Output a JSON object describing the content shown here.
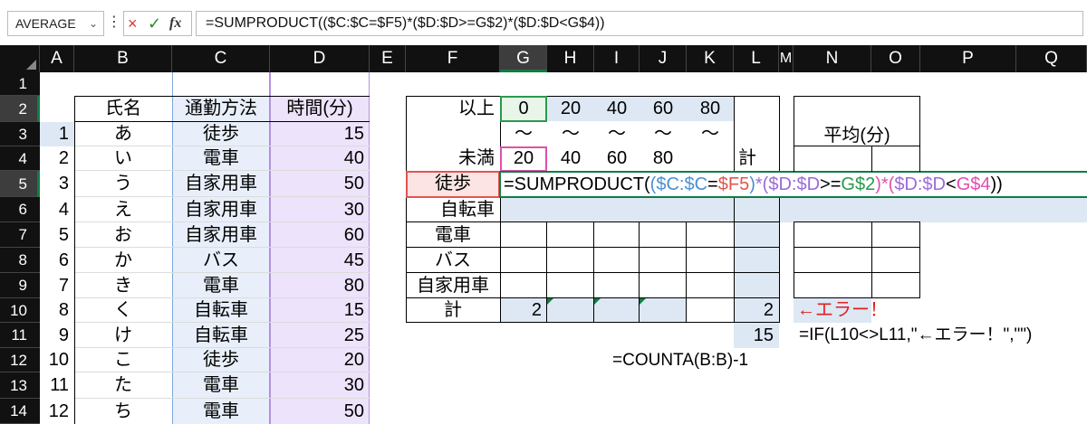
{
  "namebox": {
    "value": "AVERAGE",
    "chevron": "⌄"
  },
  "formula_bar": {
    "dots": "⋮",
    "cancel_icon": "×",
    "enter_icon": "✓",
    "fx_label": "fx",
    "text": "=SUMPRODUCT(($C:$C=$F5)*($D:$D>=G$2)*($D:$D<G$4))"
  },
  "columns": [
    "A",
    "B",
    "C",
    "D",
    "E",
    "F",
    "G",
    "H",
    "I",
    "J",
    "K",
    "L",
    "M",
    "N",
    "O",
    "P",
    "Q"
  ],
  "selected_column": "G",
  "rows": [
    "1",
    "2",
    "3",
    "4",
    "5",
    "6",
    "7",
    "8",
    "9",
    "10",
    "11",
    "12",
    "13",
    "14"
  ],
  "selected_rows": [
    "2",
    "5"
  ],
  "people": {
    "header": {
      "name": "氏名",
      "method": "通勤方法",
      "time": "時間(分)"
    },
    "list": [
      {
        "no": "1",
        "name": "あ",
        "method": "徒歩",
        "time": "15"
      },
      {
        "no": "2",
        "name": "い",
        "method": "電車",
        "time": "40"
      },
      {
        "no": "3",
        "name": "う",
        "method": "自家用車",
        "time": "50"
      },
      {
        "no": "4",
        "name": "え",
        "method": "自家用車",
        "time": "30"
      },
      {
        "no": "5",
        "name": "お",
        "method": "自家用車",
        "time": "60"
      },
      {
        "no": "6",
        "name": "か",
        "method": "バス",
        "time": "45"
      },
      {
        "no": "7",
        "name": "き",
        "method": "電車",
        "time": "80"
      },
      {
        "no": "8",
        "name": "く",
        "method": "自転車",
        "time": "15"
      },
      {
        "no": "9",
        "name": "け",
        "method": "自転車",
        "time": "25"
      },
      {
        "no": "10",
        "name": "こ",
        "method": "徒歩",
        "time": "20"
      },
      {
        "no": "11",
        "name": "た",
        "method": "電車",
        "time": "30"
      },
      {
        "no": "12",
        "name": "ち",
        "method": "電車",
        "time": "50"
      }
    ]
  },
  "crosstab": {
    "label_lower": "以上",
    "label_upper": "未満",
    "lower": [
      "0",
      "20",
      "40",
      "60",
      "80"
    ],
    "tilde": "～",
    "upper": [
      "20",
      "40",
      "60",
      "80"
    ],
    "total_col_label": "計",
    "row_labels": [
      "徒歩",
      "自転車",
      "電車",
      "バス",
      "自家用車"
    ],
    "total_row_label": "計",
    "total_g": "2",
    "total_l": "2",
    "count_value": "15",
    "editing_formula": {
      "p1": "=SUMPRODUCT(",
      "p2": "(",
      "p3": "$C:$C",
      "p4": "=",
      "p5": "$F5",
      "p6": ")",
      "p7": "*(",
      "p8": "$D:$D",
      "p9": ">=",
      "p10": "G$2",
      "p11": ")*(",
      "p12": "$D:$D",
      "p13": "<",
      "p14": "G$4",
      "p15": "))"
    }
  },
  "avg": {
    "title": "平均(分)"
  },
  "notes": {
    "error": "←エラー！",
    "if_formula": "=IF(L10<>L11,\"←エラー！\",\"\")",
    "counta_formula": "=COUNTA(B:B)-1"
  },
  "colors": {
    "accent_green": "#107c41",
    "ref_blue": "#4a8fd6",
    "ref_red": "#e0564f",
    "ref_purple": "#9b6ad8",
    "ref_green": "#2a9a4a",
    "ref_pink": "#e04fae",
    "cell_highlight": "#dde8f4",
    "error_red": "#e02020"
  }
}
